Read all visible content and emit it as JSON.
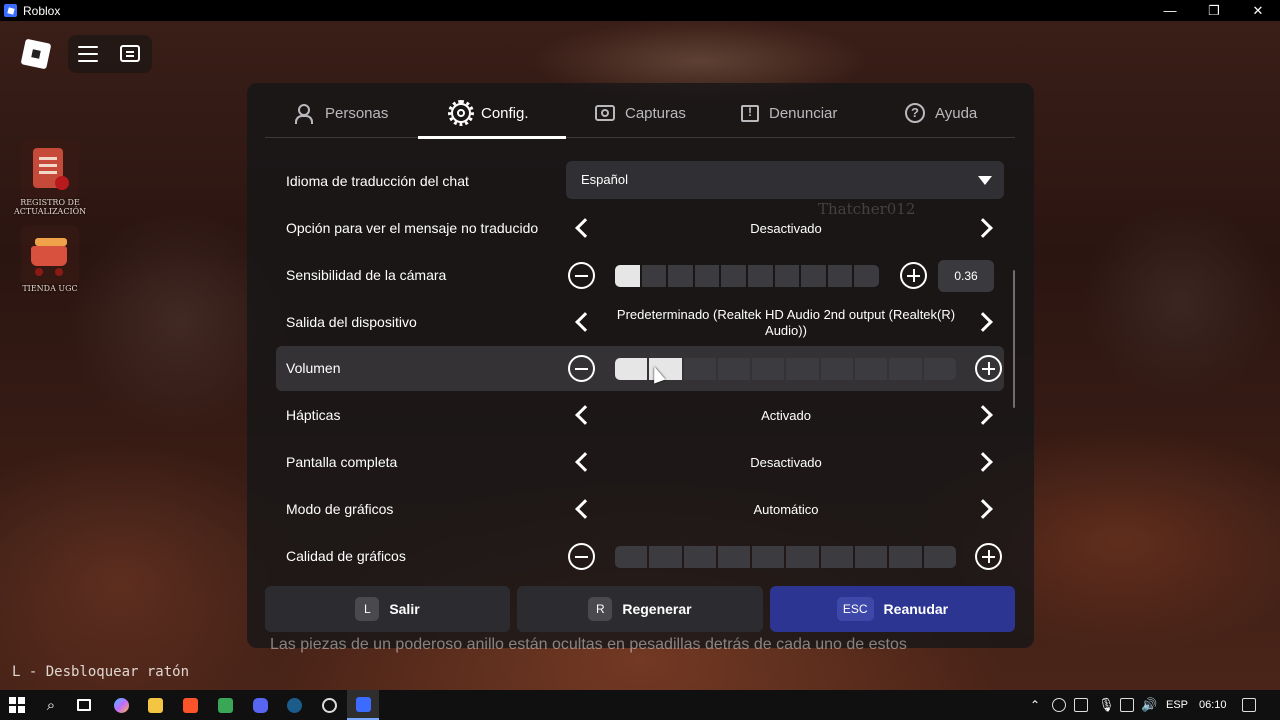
{
  "window": {
    "title": "Roblox",
    "minimize": "—",
    "maximize": "❐",
    "close": "✕"
  },
  "sidebar_buttons": [
    {
      "label": "REGISTRO DE ACTUALIZACIÓN"
    },
    {
      "label": "TIENDA UGC"
    }
  ],
  "tabs": [
    {
      "label": "Personas",
      "icon": "people-icon",
      "active": false
    },
    {
      "label": "Config.",
      "icon": "gear-icon",
      "active": true
    },
    {
      "label": "Capturas",
      "icon": "camera-icon",
      "active": false
    },
    {
      "label": "Denunciar",
      "icon": "report-icon",
      "active": false
    },
    {
      "label": "Ayuda",
      "icon": "help-icon",
      "active": false
    }
  ],
  "settings": {
    "chat_translation_language": {
      "label": "Idioma de traducción del chat",
      "value": "Español"
    },
    "show_untranslated_message": {
      "label": "Opción para ver el mensaje no traducido",
      "value": "Desactivado"
    },
    "camera_sensitivity": {
      "label": "Sensibilidad de la cámara",
      "value": "0.36",
      "level": 0.1
    },
    "device_output": {
      "label": "Salida del dispositivo",
      "value": "Predeterminado (Realtek HD Audio 2nd output (Realtek(R) Audio))"
    },
    "volume": {
      "label": "Volumen",
      "level": 0.2
    },
    "haptics": {
      "label": "Hápticas",
      "value": "Activado"
    },
    "fullscreen": {
      "label": "Pantalla completa",
      "value": "Desactivado"
    },
    "graphics_mode": {
      "label": "Modo de gráficos",
      "value": "Automático"
    },
    "graphics_quality": {
      "label": "Calidad de gráficos",
      "level": 0
    }
  },
  "overlay_player_name": "Thatcher012",
  "bottom_buttons": {
    "leave": {
      "key": "L",
      "label": "Salir"
    },
    "reset": {
      "key": "R",
      "label": "Regenerar"
    },
    "resume": {
      "key": "ESC",
      "label": "Reanudar"
    }
  },
  "caption": "Las piezas de un poderoso anillo están ocultas en pesadillas detrás de cada uno de estos",
  "unlock_hint": "L - Desbloquear ratón",
  "taskbar": {
    "language": "ESP",
    "time": "06:10"
  },
  "colors": {
    "primary_button": "#2c3592",
    "panel": "#161618"
  }
}
